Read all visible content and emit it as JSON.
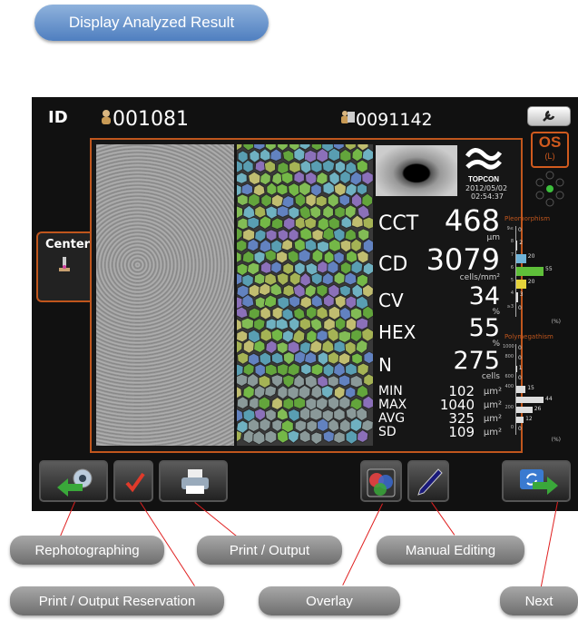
{
  "title_pill": "Display Analyzed Result",
  "header": {
    "id_label": "ID",
    "patient_id": "001081",
    "exam_id": "0091142",
    "eye": "OS",
    "eye_sub": "(L)"
  },
  "brand": "TOPCON",
  "datetime": {
    "date": "2012/05/02",
    "time": "02:54:37"
  },
  "side_tab": "Center",
  "metrics": {
    "cct": {
      "label": "CCT",
      "value": "468",
      "unit": "μm"
    },
    "cd": {
      "label": "CD",
      "value": "3079",
      "unit": "cells/mm²"
    },
    "cv": {
      "label": "CV",
      "value": "34",
      "unit": "%"
    },
    "hex": {
      "label": "HEX",
      "value": "55",
      "unit": "%"
    },
    "n": {
      "label": "N",
      "value": "275",
      "unit": "cells"
    },
    "stats": [
      {
        "label": "MIN",
        "value": "102",
        "unit": "μm²"
      },
      {
        "label": "MAX",
        "value": "1040",
        "unit": "μm²"
      },
      {
        "label": "AVG",
        "value": "325",
        "unit": "μm²"
      },
      {
        "label": "SD",
        "value": "109",
        "unit": "μm²"
      }
    ]
  },
  "pleomorphism": {
    "title": "Pleomorphism",
    "unit": "(%)",
    "axis_max": "0",
    "rows": [
      {
        "k": "9≤",
        "v": "0",
        "frac": 0
      },
      {
        "k": "8",
        "v": "2",
        "frac": 0.04
      },
      {
        "k": "7",
        "v": "20",
        "frac": 0.36,
        "color": "#6fb3d8"
      },
      {
        "k": "6",
        "v": "55",
        "frac": 1.0,
        "color": "#5fbf3a"
      },
      {
        "k": "5",
        "v": "20",
        "frac": 0.36,
        "color": "#e4d23a"
      },
      {
        "k": "4",
        "v": "3",
        "frac": 0.06
      },
      {
        "k": "≥3",
        "v": "0",
        "frac": 0
      }
    ]
  },
  "polymegathism": {
    "title": "Polymegathism",
    "unit": "(%)",
    "rows": [
      {
        "k": "1000",
        "v": "0",
        "frac": 0
      },
      {
        "k": "800",
        "v": "0",
        "frac": 0
      },
      {
        "k": "",
        "v": "1",
        "frac": 0.02
      },
      {
        "k": "600",
        "v": "0",
        "frac": 0
      },
      {
        "k": "400",
        "v": "15",
        "frac": 0.34
      },
      {
        "k": "",
        "v": "44",
        "frac": 1.0
      },
      {
        "k": "200",
        "v": "26",
        "frac": 0.59
      },
      {
        "k": "",
        "v": "12",
        "frac": 0.27
      },
      {
        "k": "0",
        "v": "0",
        "frac": 0
      }
    ]
  },
  "callouts": {
    "rephotographing": "Rephotographing",
    "print_output": "Print / Output",
    "manual_editing": "Manual Editing",
    "print_reservation": "Print / Output Reservation",
    "overlay": "Overlay",
    "next": "Next"
  }
}
